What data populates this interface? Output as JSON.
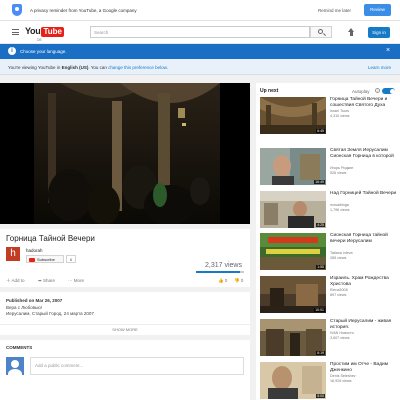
{
  "privacy": {
    "message": "A privacy reminder from YouTube, a Google company",
    "remind_later": "Remind me later",
    "review": "Review"
  },
  "masthead": {
    "logo_you": "You",
    "logo_tube": "Tube",
    "country_code": "DE",
    "search_placeholder": "Search",
    "sign_in": "Sign in"
  },
  "language": {
    "prompt": "Choose your language.",
    "current_prefix": "You're viewing YouTube in ",
    "current_language": "English (US)",
    "change_prefix": ". You can ",
    "change_link": "change this preference below",
    "change_suffix": ".",
    "learn_more": "Learn more"
  },
  "video": {
    "title": "Горница Тайной Вечери",
    "channel": "hadorah",
    "channel_initial": "h",
    "subscribe": "Subscribe",
    "subscriber_count": "6",
    "views": "2,317 views",
    "actions": {
      "add_to": "Add to",
      "share": "Share",
      "more": "More"
    },
    "likes": "0",
    "dislikes": "0"
  },
  "description": {
    "published": "Published on Mar 26, 2007",
    "line1": "Вера с Любовью!",
    "line2": "Иерусалим, Старый Город, 24 марта 2007",
    "show_more": "SHOW MORE"
  },
  "comments": {
    "header": "COMMENTS",
    "placeholder": "Add a public comment..."
  },
  "sidebar": {
    "up_next": "Up next",
    "autoplay": "Autoplay",
    "items": [
      {
        "title": "Горница Тайной Вечери и сошествия Святого Духа",
        "channel": "Israel Tours",
        "views": "4,310 views",
        "duration": "6:45"
      },
      {
        "title": "Святая Земля Иерусалим Сионская Горница в которой",
        "channel": "Игорь Ридкин",
        "views": "526 views",
        "duration": "16:49"
      },
      {
        "title": "Над Горницей Тайной Вечери",
        "channel": "mosaikfoga",
        "views": "1,796 views",
        "duration": "4:25"
      },
      {
        "title": "Сионская Горница тайной вечери Иерусалим",
        "channel": "Tatiana Ivleva",
        "views": "285 views",
        "duration": "1:55"
      },
      {
        "title": "Израиль. Храм Рождества Христова",
        "channel": "Elena3008",
        "views": "897 views",
        "duration": "10:01"
      },
      {
        "title": "Старый Иерусалим - живая история.",
        "channel": "IVAN Новости",
        "views": "3,607 views",
        "duration": "6:19"
      },
      {
        "title": "Простим им Отче - Вадим Дженкино",
        "channel": "Denis Seleshev",
        "views": "16,926 views",
        "duration": "5:00"
      }
    ]
  },
  "colors": {
    "brand_red": "#e62117",
    "accent_blue": "#167ac6",
    "language_bar": "#1a6fc4"
  }
}
